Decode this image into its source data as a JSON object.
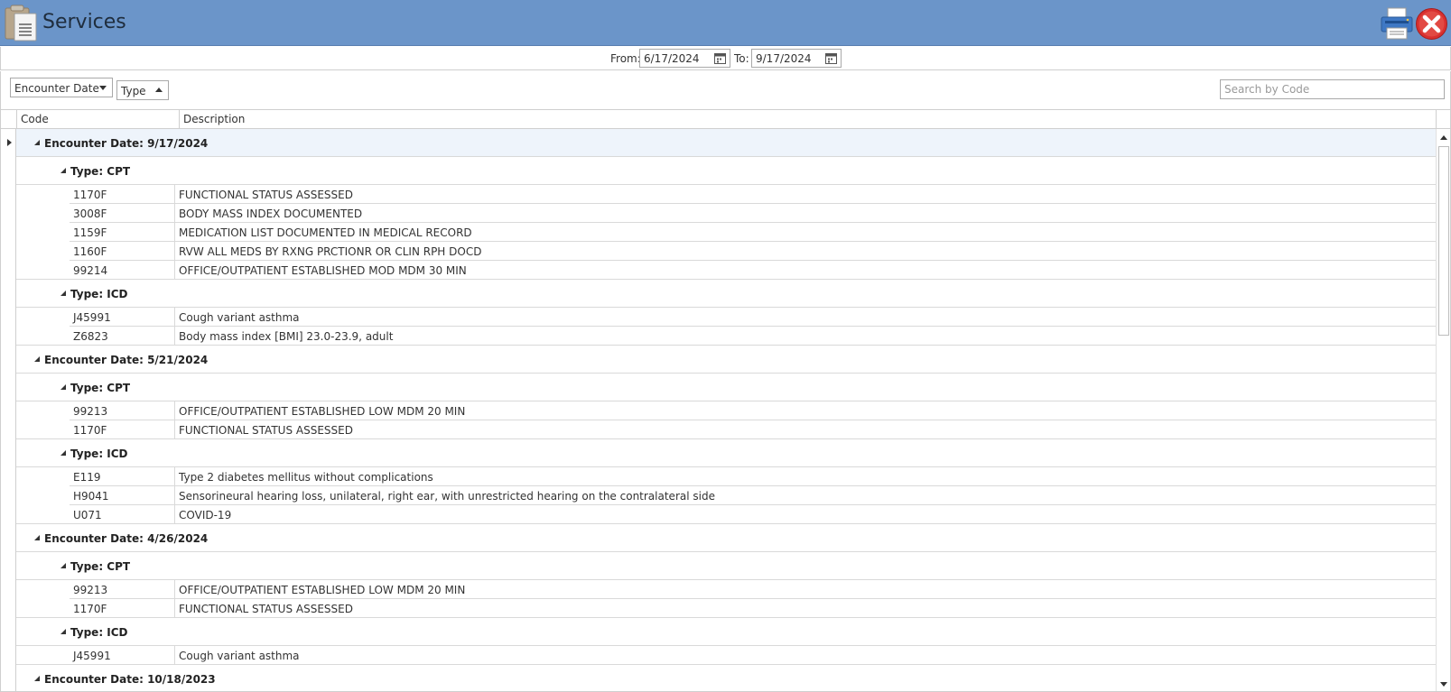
{
  "window": {
    "title": "Services"
  },
  "dates": {
    "from_label": "From:",
    "from_value": "6/17/2024",
    "to_label": "To:",
    "to_value": "9/17/2024"
  },
  "grouping": {
    "chip1_label": "Encounter Date",
    "chip2_label": "Type"
  },
  "search": {
    "placeholder": "Search by Code"
  },
  "columns": {
    "code": "Code",
    "description": "Description"
  },
  "encounters": [
    {
      "label": "Encounter Date: 9/17/2024",
      "types": [
        {
          "label": "Type: CPT",
          "rows": [
            {
              "code": "1170F",
              "desc": "FUNCTIONAL STATUS ASSESSED"
            },
            {
              "code": "3008F",
              "desc": "BODY MASS INDEX DOCUMENTED"
            },
            {
              "code": "1159F",
              "desc": "MEDICATION LIST DOCUMENTED IN MEDICAL RECORD"
            },
            {
              "code": "1160F",
              "desc": "RVW ALL MEDS BY RXNG PRCTIONR OR CLIN RPH DOCD"
            },
            {
              "code": "99214",
              "desc": "OFFICE/OUTPATIENT ESTABLISHED MOD MDM 30 MIN"
            }
          ]
        },
        {
          "label": "Type: ICD",
          "rows": [
            {
              "code": "J45991",
              "desc": "Cough variant asthma"
            },
            {
              "code": "Z6823",
              "desc": "Body mass index [BMI] 23.0-23.9, adult"
            }
          ]
        }
      ]
    },
    {
      "label": "Encounter Date: 5/21/2024",
      "types": [
        {
          "label": "Type: CPT",
          "rows": [
            {
              "code": "99213",
              "desc": "OFFICE/OUTPATIENT ESTABLISHED LOW MDM 20 MIN"
            },
            {
              "code": "1170F",
              "desc": "FUNCTIONAL STATUS ASSESSED"
            }
          ]
        },
        {
          "label": "Type: ICD",
          "rows": [
            {
              "code": "E119",
              "desc": "Type 2 diabetes mellitus without complications"
            },
            {
              "code": "H9041",
              "desc": "Sensorineural hearing loss, unilateral, right ear, with unrestricted hearing on the contralateral side"
            },
            {
              "code": "U071",
              "desc": "COVID-19"
            }
          ]
        }
      ]
    },
    {
      "label": "Encounter Date: 4/26/2024",
      "types": [
        {
          "label": "Type: CPT",
          "rows": [
            {
              "code": "99213",
              "desc": "OFFICE/OUTPATIENT ESTABLISHED LOW MDM 20 MIN"
            },
            {
              "code": "1170F",
              "desc": "FUNCTIONAL STATUS ASSESSED"
            }
          ]
        },
        {
          "label": "Type: ICD",
          "rows": [
            {
              "code": "J45991",
              "desc": "Cough variant asthma"
            }
          ]
        }
      ]
    },
    {
      "label": "Encounter Date: 10/18/2023",
      "types": []
    }
  ],
  "colors": {
    "titlebar": "#6b95c9",
    "selected_row": "#eef4fb",
    "close": "#d9302f"
  },
  "icons": {
    "app": "clipboard-list-icon",
    "print": "printer-icon",
    "close": "close-icon",
    "calendar": "calendar-icon"
  }
}
